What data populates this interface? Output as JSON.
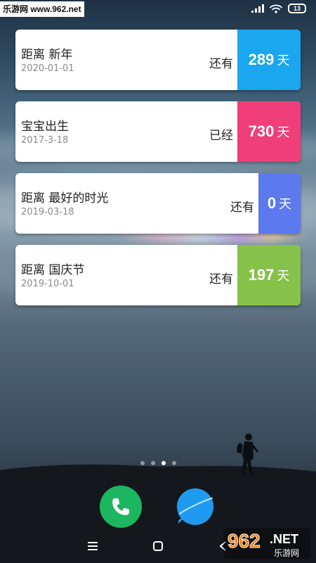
{
  "status_bar": {
    "watermark": "乐游网 www.962.net",
    "battery_level": "13"
  },
  "cards": [
    {
      "title": "距离 新年",
      "date": "2020-01-01",
      "status": "还有",
      "days": "289",
      "unit": "天",
      "color": "#1aa7f0"
    },
    {
      "title": "宝宝出生",
      "date": "2017-3-18",
      "status": "已经",
      "days": "730",
      "unit": "天",
      "color": "#f03e7a"
    },
    {
      "title": "距离 最好的时光",
      "date": "2019-03-18",
      "status": "还有",
      "days": "0",
      "unit": "天",
      "color": "#5c79f0"
    },
    {
      "title": "距离 国庆节",
      "date": "2019-10-01",
      "status": "还有",
      "days": "197",
      "unit": "天",
      "color": "#86c24a"
    }
  ],
  "page_indicator": {
    "total": 4,
    "active_index": 2
  },
  "dock": [
    {
      "icon": "phone-icon",
      "color": "#1db660"
    },
    {
      "icon": "messages-icon",
      "color": "#1e9bf0"
    }
  ],
  "nav_bar": [
    {
      "icon": "menu-icon"
    },
    {
      "icon": "home-icon"
    },
    {
      "icon": "back-icon"
    }
  ],
  "watermark_bottom": {
    "logo_text": "962",
    "suffix": ".NET",
    "subtitle": "乐游网"
  }
}
